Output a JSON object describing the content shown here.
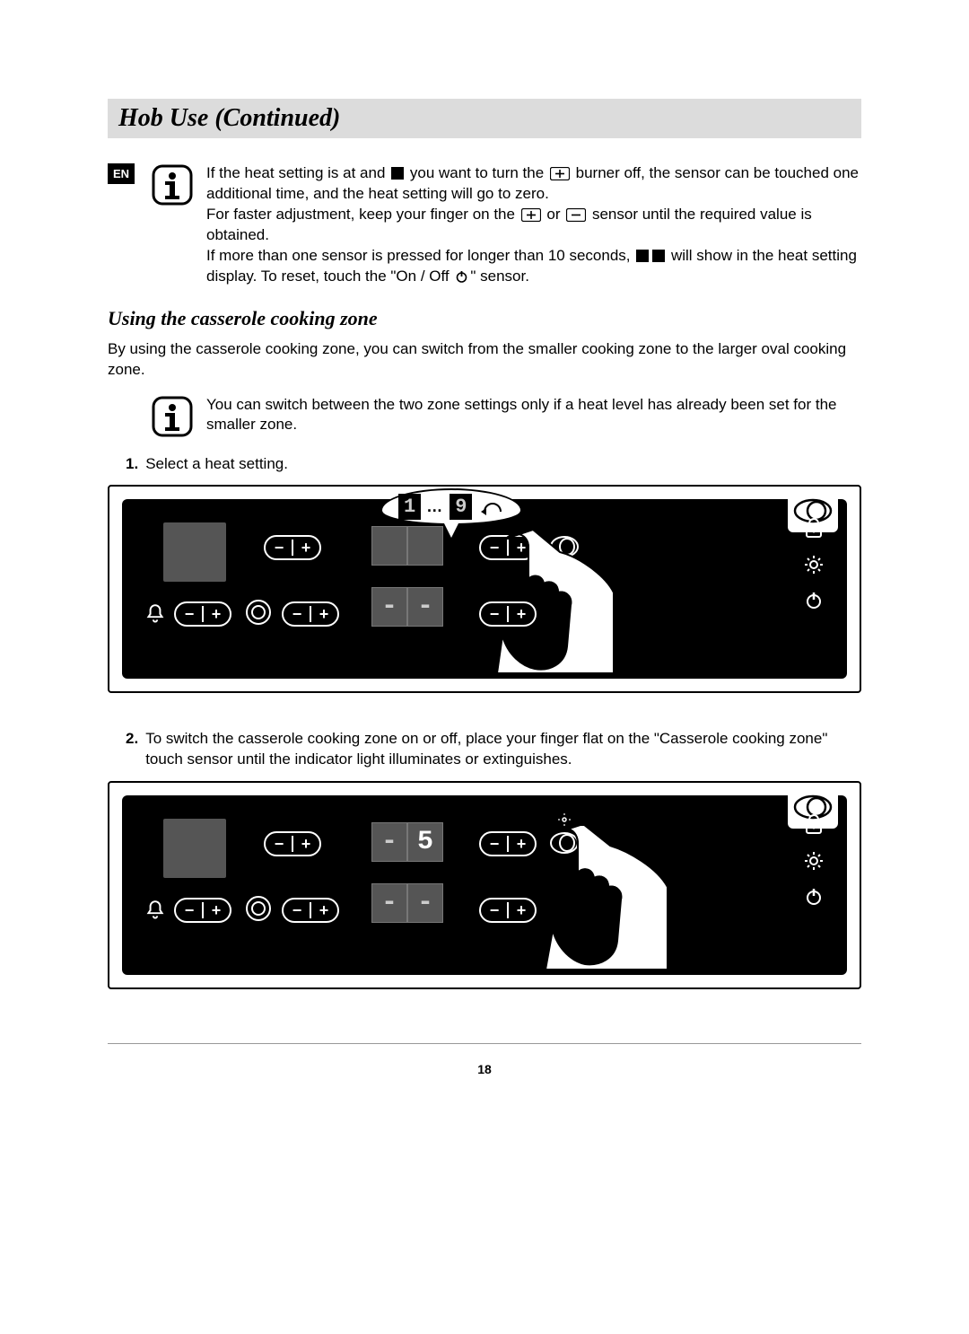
{
  "title": "Hob Use (Continued)",
  "lang_badge": "EN",
  "note1": {
    "line1a": "If the heat setting is at and ",
    "line1b": " you want to turn the ",
    "line1c": " burner off, the sensor can be touched one additional time, and the heat setting will go to zero.",
    "line2a": "For faster adjustment, keep your finger on the ",
    "line2b": " or ",
    "line2c": " sensor until the required value is obtained.",
    "line3a": "If more than one sensor is pressed for longer than 10 seconds, ",
    "line3b": " will show in the heat setting display. To reset, touch the \"On / Off ",
    "line3c": "\" sensor."
  },
  "subhead": "Using the casserole cooking zone",
  "intro": "By using the casserole cooking zone, you can switch from the smaller cooking zone to the larger oval cooking zone.",
  "note2": "You can switch between the two zone settings only if a heat level has already been set for the smaller zone.",
  "step1_num": "1.",
  "step1_text": "Select a heat setting.",
  "step2_num": "2.",
  "step2_text": "To switch the casserole cooking zone on or off, place your finger flat on the \"Casserole cooking zone\" touch sensor until the indicator light illuminates or extinguishes.",
  "fig1_bubble": {
    "d1": "1",
    "dots": "…",
    "d9": "9"
  },
  "fig2_display": {
    "dash": "-",
    "five": "5"
  },
  "page_number": "18"
}
